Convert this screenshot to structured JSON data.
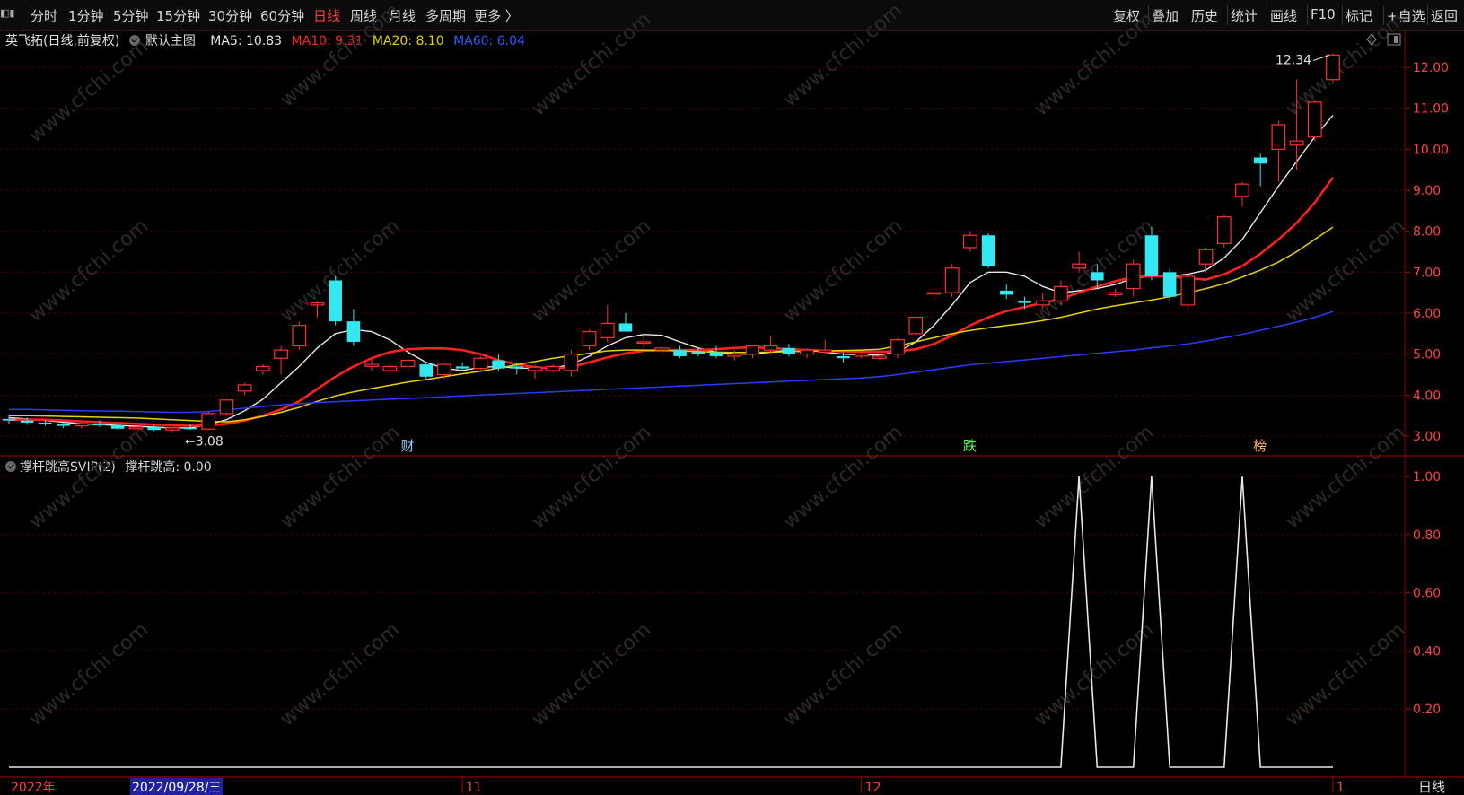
{
  "toolbar": {
    "left_items": [
      "分时",
      "1分钟",
      "5分钟",
      "15分钟",
      "30分钟",
      "60分钟",
      "日线",
      "周线",
      "月线",
      "多周期",
      "更多 〉"
    ],
    "active": "日线",
    "right_items": [
      "复权",
      "叠加",
      "历史",
      "统计",
      "画线",
      "F10",
      "标记",
      "+自选",
      "返回"
    ]
  },
  "legend": {
    "title": "英飞拓(日线,前复权)",
    "main_chart": "默认主图",
    "ma5": "MA5: 10.83",
    "ma10": "MA10: 9.31",
    "ma20": "MA20: 8.10",
    "ma60": "MA60: 6.04",
    "colors": {
      "ma5": "#e8e8e8",
      "ma10": "#ff2020",
      "ma20": "#e6d200",
      "ma60": "#2a3cff"
    }
  },
  "sub_legend": {
    "indicator": "撑杆跳高SVIP(2)",
    "value": "撑杆跳高: 0.00"
  },
  "chart_data": [
    {
      "type": "candlestick",
      "y_axis_ticks": [
        "12.00",
        "11.00",
        "10.00",
        "9.00",
        "8.00",
        "7.00",
        "6.00",
        "5.00",
        "4.00",
        "3.00"
      ],
      "ylim": [
        2.7,
        12.5
      ],
      "annotations": {
        "high": "12.34",
        "low": "3.08"
      },
      "event_markers": [
        "财",
        "跌",
        "榜"
      ],
      "candles": [
        [
          3.42,
          3.5,
          3.3,
          3.38
        ],
        [
          3.38,
          3.45,
          3.28,
          3.33
        ],
        [
          3.33,
          3.4,
          3.25,
          3.3
        ],
        [
          3.3,
          3.36,
          3.2,
          3.25
        ],
        [
          3.25,
          3.33,
          3.18,
          3.3
        ],
        [
          3.3,
          3.38,
          3.22,
          3.26
        ],
        [
          3.26,
          3.3,
          3.15,
          3.18
        ],
        [
          3.18,
          3.26,
          3.1,
          3.22
        ],
        [
          3.22,
          3.28,
          3.12,
          3.15
        ],
        [
          3.15,
          3.22,
          3.08,
          3.2
        ],
        [
          3.2,
          3.3,
          3.15,
          3.17
        ],
        [
          3.17,
          3.6,
          3.15,
          3.55
        ],
        [
          3.55,
          3.9,
          3.5,
          3.88
        ],
        [
          4.1,
          4.3,
          4.0,
          4.25
        ],
        [
          4.6,
          4.75,
          4.5,
          4.7
        ],
        [
          4.9,
          5.2,
          4.5,
          5.1
        ],
        [
          5.2,
          5.8,
          5.1,
          5.7
        ],
        [
          6.2,
          6.3,
          5.9,
          6.25
        ],
        [
          6.8,
          6.9,
          5.7,
          5.8
        ],
        [
          5.8,
          6.1,
          5.2,
          5.3
        ],
        [
          4.7,
          4.9,
          4.6,
          4.75
        ],
        [
          4.6,
          4.8,
          4.55,
          4.7
        ],
        [
          4.7,
          4.9,
          4.55,
          4.85
        ],
        [
          4.75,
          4.8,
          4.4,
          4.45
        ],
        [
          4.5,
          4.8,
          4.4,
          4.75
        ],
        [
          4.7,
          4.8,
          4.6,
          4.65
        ],
        [
          4.65,
          4.95,
          4.6,
          4.9
        ],
        [
          4.85,
          5.0,
          4.6,
          4.65
        ],
        [
          4.7,
          4.8,
          4.5,
          4.65
        ],
        [
          4.6,
          4.75,
          4.4,
          4.68
        ],
        [
          4.6,
          4.75,
          4.55,
          4.7
        ],
        [
          4.6,
          5.1,
          4.45,
          5.0
        ],
        [
          5.2,
          5.6,
          5.1,
          5.55
        ],
        [
          5.4,
          6.2,
          5.3,
          5.75
        ],
        [
          5.75,
          6.0,
          5.6,
          5.55
        ],
        [
          5.3,
          5.5,
          5.15,
          5.3
        ],
        [
          5.1,
          5.2,
          5.0,
          5.15
        ],
        [
          5.1,
          5.2,
          4.9,
          4.95
        ],
        [
          5.05,
          5.15,
          4.95,
          5.0
        ],
        [
          5.05,
          5.2,
          4.9,
          4.95
        ],
        [
          4.95,
          5.1,
          4.85,
          5.0
        ],
        [
          5.0,
          5.15,
          4.9,
          5.2
        ],
        [
          5.1,
          5.45,
          5.0,
          5.2
        ],
        [
          5.15,
          5.25,
          4.95,
          5.0
        ],
        [
          5.0,
          5.15,
          4.9,
          5.1
        ],
        [
          5.05,
          5.35,
          5.0,
          5.1
        ],
        [
          4.95,
          5.05,
          4.8,
          4.9
        ],
        [
          4.95,
          5.05,
          4.9,
          5.0
        ],
        [
          4.9,
          5.0,
          4.85,
          4.95
        ],
        [
          5.0,
          5.4,
          4.9,
          5.35
        ],
        [
          5.5,
          5.9,
          5.45,
          5.9
        ],
        [
          6.5,
          6.5,
          6.3,
          6.5
        ],
        [
          6.5,
          7.2,
          6.4,
          7.1
        ],
        [
          7.6,
          8.0,
          7.5,
          7.9
        ],
        [
          7.9,
          7.95,
          7.1,
          7.15
        ],
        [
          6.55,
          6.7,
          6.35,
          6.45
        ],
        [
          6.3,
          6.4,
          6.1,
          6.25
        ],
        [
          6.2,
          6.5,
          6.1,
          6.3
        ],
        [
          6.3,
          6.8,
          6.2,
          6.65
        ],
        [
          7.1,
          7.5,
          7.0,
          7.2
        ],
        [
          7.0,
          7.2,
          6.6,
          6.8
        ],
        [
          6.45,
          6.6,
          6.4,
          6.5
        ],
        [
          6.6,
          7.3,
          6.4,
          7.2
        ],
        [
          7.9,
          8.1,
          6.8,
          6.9
        ],
        [
          7.0,
          7.1,
          6.3,
          6.4
        ],
        [
          6.2,
          6.9,
          6.1,
          6.9
        ],
        [
          7.2,
          7.6,
          7.0,
          7.55
        ],
        [
          7.7,
          8.4,
          7.6,
          8.35
        ],
        [
          8.85,
          9.2,
          8.6,
          9.15
        ],
        [
          9.8,
          9.9,
          9.1,
          9.65
        ],
        [
          10.0,
          10.7,
          9.2,
          10.6
        ],
        [
          10.1,
          11.7,
          9.5,
          10.2
        ],
        [
          10.3,
          11.2,
          10.2,
          11.15
        ],
        [
          11.7,
          12.34,
          11.6,
          12.3
        ]
      ],
      "series": [
        {
          "name": "MA5",
          "values": [
            3.45,
            3.42,
            3.38,
            3.34,
            3.3,
            3.28,
            3.26,
            3.24,
            3.22,
            3.2,
            3.2,
            3.28,
            3.4,
            3.62,
            3.9,
            4.3,
            4.7,
            5.15,
            5.5,
            5.6,
            5.55,
            5.35,
            5.05,
            4.8,
            4.65,
            4.6,
            4.68,
            4.7,
            4.66,
            4.65,
            4.66,
            4.75,
            4.95,
            5.2,
            5.4,
            5.48,
            5.46,
            5.3,
            5.15,
            5.05,
            5.0,
            5.0,
            5.05,
            5.1,
            5.1,
            5.05,
            5.0,
            4.98,
            4.98,
            5.05,
            5.3,
            5.7,
            6.2,
            6.75,
            7.0,
            7.0,
            6.9,
            6.65,
            6.5,
            6.55,
            6.6,
            6.7,
            6.85,
            6.9,
            6.9,
            6.95,
            7.05,
            7.35,
            7.8,
            8.45,
            9.1,
            9.7,
            10.3,
            10.83
          ]
        },
        {
          "name": "MA10",
          "values": [
            3.4,
            3.4,
            3.4,
            3.38,
            3.36,
            3.34,
            3.32,
            3.3,
            3.28,
            3.26,
            3.25,
            3.26,
            3.3,
            3.38,
            3.5,
            3.65,
            3.85,
            4.15,
            4.45,
            4.7,
            4.9,
            5.05,
            5.12,
            5.14,
            5.14,
            5.1,
            5.0,
            4.85,
            4.75,
            4.68,
            4.65,
            4.68,
            4.8,
            4.92,
            5.02,
            5.08,
            5.1,
            5.1,
            5.1,
            5.12,
            5.15,
            5.17,
            5.15,
            5.12,
            5.1,
            5.08,
            5.07,
            5.06,
            5.06,
            5.07,
            5.12,
            5.25,
            5.45,
            5.7,
            5.9,
            6.05,
            6.15,
            6.25,
            6.35,
            6.5,
            6.65,
            6.78,
            6.88,
            6.9,
            6.9,
            6.85,
            6.82,
            6.95,
            7.15,
            7.45,
            7.8,
            8.2,
            8.7,
            9.31
          ]
        },
        {
          "name": "MA20",
          "values": [
            3.5,
            3.5,
            3.49,
            3.48,
            3.47,
            3.46,
            3.45,
            3.44,
            3.42,
            3.4,
            3.38,
            3.36,
            3.35,
            3.4,
            3.48,
            3.58,
            3.7,
            3.85,
            3.98,
            4.08,
            4.16,
            4.24,
            4.32,
            4.38,
            4.45,
            4.52,
            4.58,
            4.66,
            4.74,
            4.82,
            4.9,
            4.96,
            5.02,
            5.08,
            5.1,
            5.1,
            5.09,
            5.08,
            5.06,
            5.05,
            5.04,
            5.04,
            5.05,
            5.06,
            5.07,
            5.08,
            5.09,
            5.1,
            5.12,
            5.2,
            5.3,
            5.4,
            5.5,
            5.58,
            5.64,
            5.7,
            5.75,
            5.82,
            5.9,
            6.0,
            6.1,
            6.18,
            6.25,
            6.32,
            6.4,
            6.5,
            6.6,
            6.72,
            6.88,
            7.05,
            7.25,
            7.5,
            7.8,
            8.1
          ]
        },
        {
          "name": "MA60",
          "values": [
            3.65,
            3.65,
            3.64,
            3.63,
            3.62,
            3.61,
            3.61,
            3.6,
            3.59,
            3.58,
            3.58,
            3.6,
            3.64,
            3.68,
            3.72,
            3.76,
            3.79,
            3.82,
            3.84,
            3.86,
            3.88,
            3.9,
            3.92,
            3.94,
            3.96,
            3.98,
            4.0,
            4.02,
            4.04,
            4.06,
            4.08,
            4.1,
            4.12,
            4.14,
            4.16,
            4.18,
            4.2,
            4.22,
            4.24,
            4.26,
            4.28,
            4.3,
            4.32,
            4.34,
            4.36,
            4.38,
            4.4,
            4.42,
            4.45,
            4.5,
            4.56,
            4.62,
            4.68,
            4.74,
            4.78,
            4.82,
            4.86,
            4.9,
            4.94,
            4.98,
            5.02,
            5.06,
            5.1,
            5.15,
            5.2,
            5.25,
            5.32,
            5.4,
            5.48,
            5.58,
            5.68,
            5.78,
            5.9,
            6.04
          ]
        }
      ]
    },
    {
      "type": "line",
      "title": "撑杆跳高SVIP(2)",
      "y_axis_ticks": [
        "1.00",
        "0.80",
        "0.60",
        "0.40",
        "0.20"
      ],
      "ylim": [
        0,
        1.0
      ],
      "series": [
        {
          "name": "撑杆跳高",
          "values": [
            0,
            0,
            0,
            0,
            0,
            0,
            0,
            0,
            0,
            0,
            0,
            0,
            0,
            0,
            0,
            0,
            0,
            0,
            0,
            0,
            0,
            0,
            0,
            0,
            0,
            0,
            0,
            0,
            0,
            0,
            0,
            0,
            0,
            0,
            0,
            0,
            0,
            0,
            0,
            0,
            0,
            0,
            0,
            0,
            0,
            0,
            0,
            0,
            0,
            0,
            0,
            0,
            0,
            0,
            0,
            0,
            0,
            0,
            0,
            1,
            0,
            0,
            0,
            1,
            0,
            0,
            0,
            0,
            1,
            0,
            0,
            0,
            0,
            0
          ]
        }
      ]
    }
  ],
  "x_axis": {
    "labels": [
      "2022年",
      "2022/09/28/三",
      "11",
      "12",
      "1"
    ],
    "period": "日线"
  }
}
